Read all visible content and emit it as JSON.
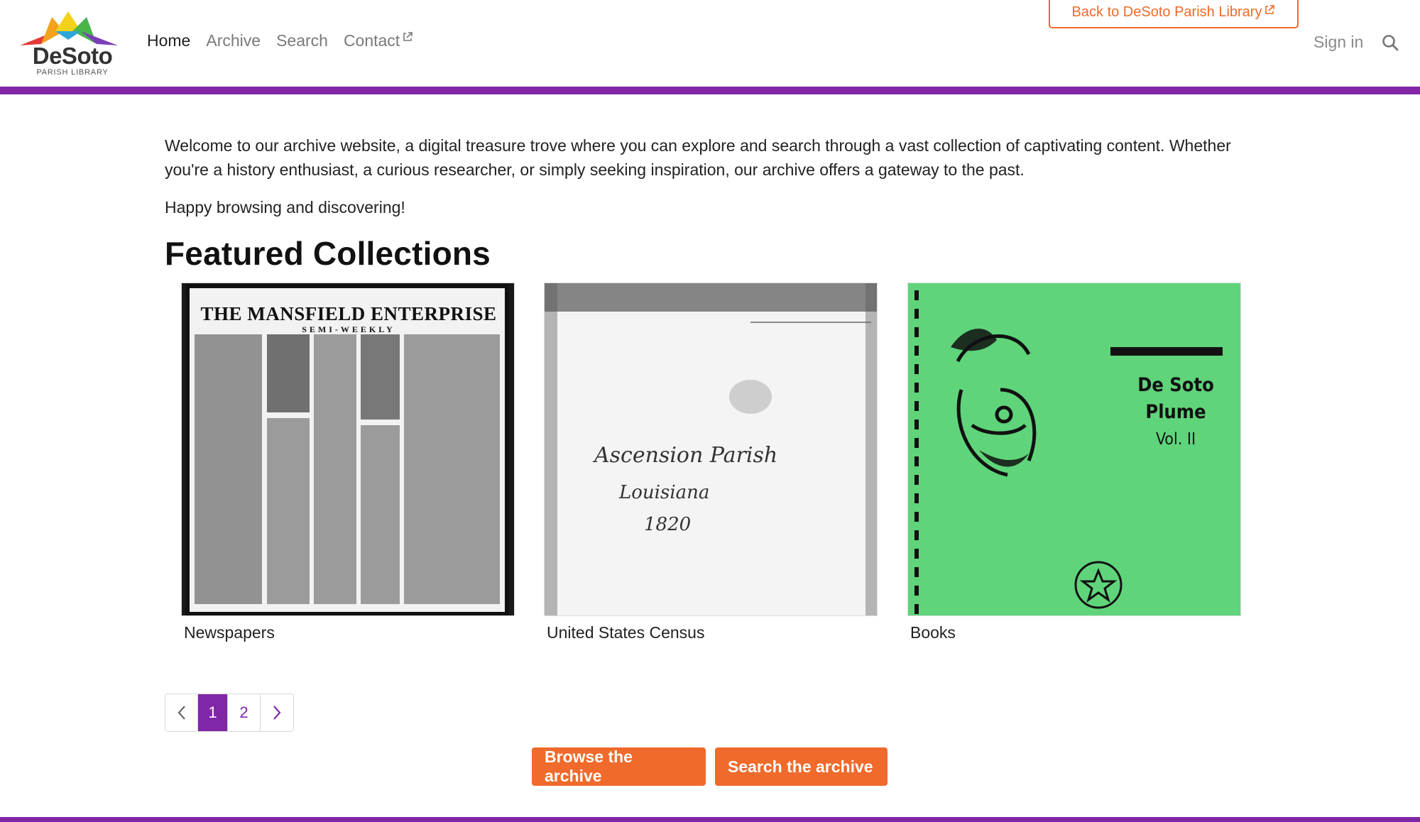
{
  "header": {
    "logo": {
      "word": "DeSoto",
      "sub": "PARISH LIBRARY"
    },
    "nav": [
      {
        "label": "Home",
        "active": true
      },
      {
        "label": "Archive",
        "active": false
      },
      {
        "label": "Search",
        "active": false
      },
      {
        "label": "Contact",
        "active": false,
        "external": true
      }
    ],
    "back_button": "Back to DeSoto Parish Library",
    "sign_in": "Sign in",
    "search_icon": "search-icon"
  },
  "colors": {
    "accent_purple": "#8126a6",
    "accent_orange": "#ef6a2b",
    "books_green": "#5fd47a"
  },
  "intro": {
    "paragraph": "Welcome to our archive website, a digital treasure trove where you can explore and search through a vast collection of captivating content. Whether you're a history enthusiast, a curious researcher, or simply seeking inspiration, our archive offers a gateway to the past.",
    "happy": "Happy browsing and discovering!"
  },
  "featured": {
    "title": "Featured Collections",
    "collections": [
      {
        "label": "Newspapers",
        "thumb": {
          "masthead": "THE MANSFIELD ENTERPRISE",
          "subhead": "SEMI-WEEKLY"
        }
      },
      {
        "label": "United States Census",
        "thumb": {
          "line1": "Ascension Parish",
          "line2": "Louisiana",
          "line3": "1820"
        }
      },
      {
        "label": "Books",
        "thumb": {
          "line1": "De Soto",
          "line2": "Plume",
          "line3": "Vol. II"
        }
      }
    ]
  },
  "pagination": {
    "prev": "‹",
    "pages": [
      "1",
      "2"
    ],
    "current": "1",
    "next": "›"
  },
  "actions": {
    "browse": "Browse the archive",
    "search": "Search the archive"
  }
}
